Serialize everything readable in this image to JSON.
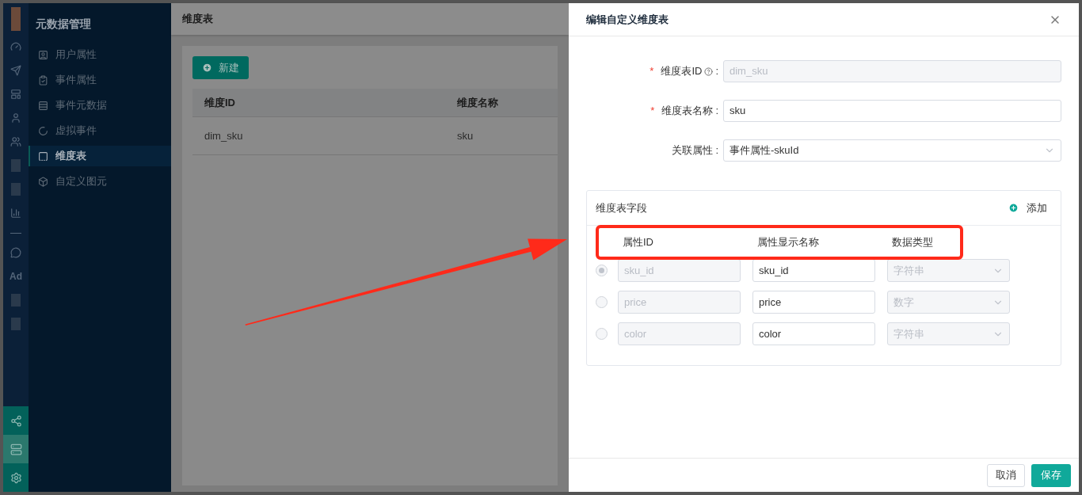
{
  "rail": {
    "top": [
      {
        "kind": "logo"
      },
      {
        "kind": "gauge"
      },
      {
        "kind": "send"
      },
      {
        "kind": "layout"
      },
      {
        "kind": "user"
      },
      {
        "kind": "users"
      },
      {
        "kind": "block"
      },
      {
        "kind": "block"
      },
      {
        "kind": "chart"
      },
      {
        "kind": "line"
      },
      {
        "kind": "chat"
      },
      {
        "kind": "text",
        "label": "Ad"
      },
      {
        "kind": "block"
      },
      {
        "kind": "block"
      }
    ],
    "bottom": [
      {
        "kind": "share",
        "selected": false
      },
      {
        "kind": "server",
        "selected": true
      },
      {
        "kind": "settings",
        "selected": false
      }
    ]
  },
  "sidebar": {
    "title": "元数据管理",
    "items": [
      {
        "kind": "user-attr",
        "label": "用户属性",
        "selected": false
      },
      {
        "kind": "event-attr",
        "label": "事件属性",
        "selected": false
      },
      {
        "kind": "event-meta",
        "label": "事件元数据",
        "selected": false
      },
      {
        "kind": "virtual",
        "label": "虚拟事件",
        "selected": false
      },
      {
        "kind": "dim",
        "label": "维度表",
        "selected": true
      },
      {
        "kind": "custom",
        "label": "自定义图元",
        "selected": false
      }
    ]
  },
  "page": {
    "title": "维度表",
    "new_button": "新建",
    "table": {
      "columns": [
        "维度ID",
        "维度名称"
      ],
      "rows": [
        [
          "dim_sku",
          "sku"
        ]
      ]
    }
  },
  "drawer": {
    "title": "编辑自定义维度表",
    "fields": [
      {
        "kind": "input",
        "mark": "*",
        "label": "维度表ID",
        "help": true,
        "colon": ":",
        "value": "dim_sku",
        "disabled": true
      },
      {
        "kind": "input",
        "mark": "*",
        "label": "维度表名称",
        "colon": ":",
        "value": "sku",
        "disabled": false
      },
      {
        "kind": "select",
        "label": "关联属性",
        "colon": ":",
        "value": "事件属性-skuId",
        "disabled": false
      }
    ],
    "section": {
      "title": "维度表字段",
      "add": "添加",
      "columns": [
        "属性ID",
        "属性显示名称",
        "数据类型"
      ],
      "rows": [
        {
          "selected": true,
          "id": "sku_id",
          "name": "sku_id",
          "type": "字符串"
        },
        {
          "selected": false,
          "id": "price",
          "name": "price",
          "type": "数字"
        },
        {
          "selected": false,
          "id": "color",
          "name": "color",
          "type": "字符串"
        }
      ]
    },
    "buttons": {
      "cancel": "取消",
      "save": "保存"
    }
  }
}
